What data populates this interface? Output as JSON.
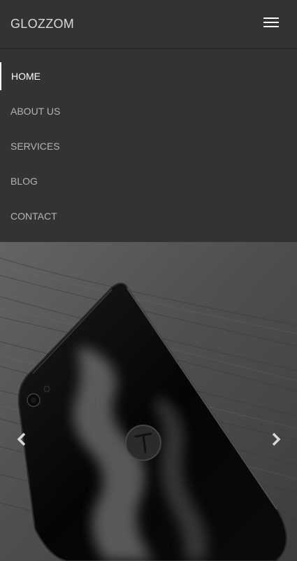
{
  "header": {
    "brand": "GLOZZOM",
    "menu_icon": "hamburger-menu-icon"
  },
  "nav": {
    "items": [
      {
        "label": "HOME",
        "active": true
      },
      {
        "label": "ABOUT US",
        "active": false
      },
      {
        "label": "SERVICES",
        "active": false
      },
      {
        "label": "BLOG",
        "active": false
      },
      {
        "label": "CONTACT",
        "active": false
      }
    ]
  },
  "hero": {
    "image": "black-smartphone-on-wood-photo",
    "prev_icon": "chevron-left-icon",
    "next_icon": "chevron-right-icon"
  },
  "colors": {
    "background": "#333333",
    "text_active": "#ffffff",
    "text_muted": "#b5b5b5"
  }
}
